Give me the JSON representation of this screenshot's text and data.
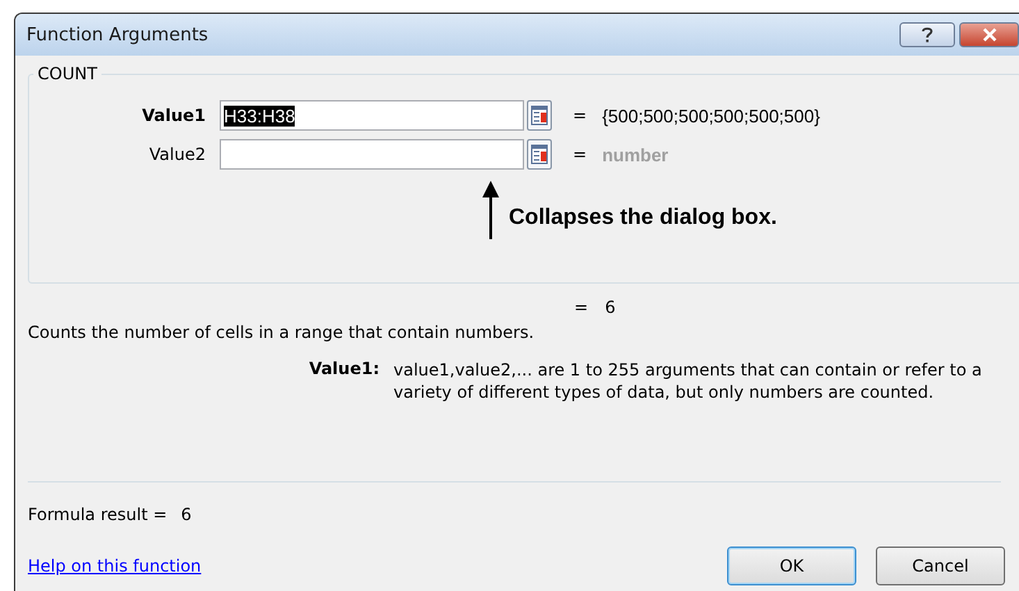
{
  "window": {
    "title": "Function Arguments"
  },
  "function_name": "COUNT",
  "arguments": [
    {
      "label": "Value1",
      "active": true,
      "value": "H33:H38",
      "selected": true,
      "equals": "=",
      "result": "{500;500;500;500;500;500}",
      "kind": "value"
    },
    {
      "label": "Value2",
      "active": false,
      "equals": "=",
      "result": "number",
      "kind": "hint"
    }
  ],
  "annotation": "Collapses the dialog box.",
  "result_line": {
    "equals": "=",
    "value": "6"
  },
  "description": "Counts the number of cells in a range that contain numbers.",
  "argument_help": {
    "label": "Value1:",
    "text": "value1,value2,... are 1 to 255 arguments that can contain or refer to a variety of different types of data, but only numbers are counted."
  },
  "formula_result": {
    "label": "Formula result =",
    "value": "6"
  },
  "help_link": "Help on this function",
  "buttons": [
    {
      "label": "OK",
      "default": true
    },
    {
      "label": "Cancel",
      "default": false
    }
  ]
}
